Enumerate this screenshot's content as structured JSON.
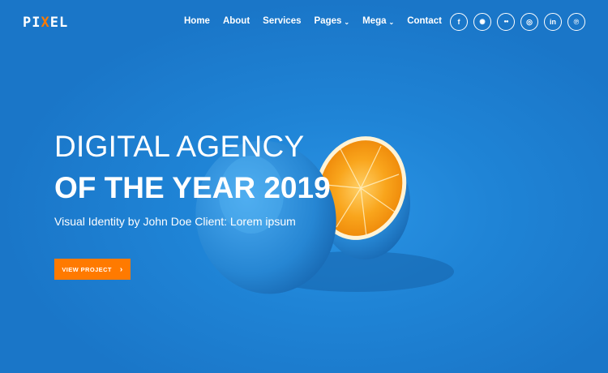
{
  "brand": {
    "logo_text": "PIXEL"
  },
  "nav": {
    "items": [
      {
        "label": "Home"
      },
      {
        "label": "About"
      },
      {
        "label": "Services"
      },
      {
        "label": "Pages",
        "dropdown": true
      },
      {
        "label": "Mega",
        "dropdown": true
      },
      {
        "label": "Contact"
      }
    ]
  },
  "socials": [
    {
      "icon": "facebook-icon",
      "glyph": "f"
    },
    {
      "icon": "dribbble-icon",
      "glyph": "✺"
    },
    {
      "icon": "flickr-icon",
      "glyph": "●●"
    },
    {
      "icon": "instagram-icon",
      "glyph": "◎"
    },
    {
      "icon": "linkedin-icon",
      "glyph": "in"
    },
    {
      "icon": "pinterest-icon",
      "glyph": "℗"
    }
  ],
  "hero": {
    "headline_line1": "DIGITAL AGENCY",
    "headline_line2": "OF THE YEAR 2019",
    "subline": "Visual Identity by John Doe Client: Lorem ipsum",
    "cta_label": "VIEW PROJECT",
    "cta_arrow": "›"
  },
  "colors": {
    "background": "#1e7fd1",
    "accent": "#ff7a00",
    "orange_flesh": "#f9a51c"
  }
}
